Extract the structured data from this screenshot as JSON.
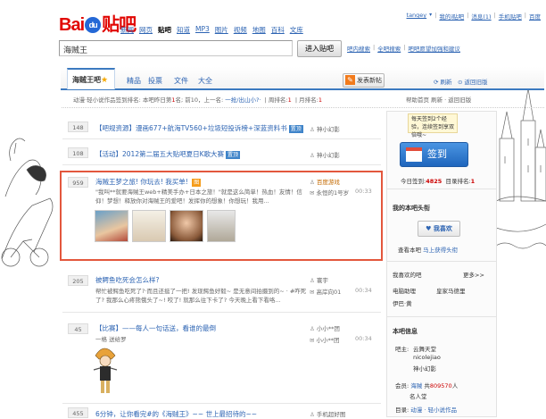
{
  "header": {
    "logo_text_bai": "Bai",
    "logo_text_du": "du",
    "logo_text_tieba": "贴吧",
    "nav": [
      "新闻",
      "网页",
      "贴吧",
      "知道",
      "MP3",
      "图片",
      "视频",
      "地图",
      "百科",
      "文库"
    ],
    "nav_current": "贴吧",
    "user": {
      "username": "tangey",
      "links": [
        "我的i贴吧",
        "消息(1)",
        "手机贴吧",
        "百度"
      ]
    },
    "search_value": "海贼王",
    "search_button": "进入贴吧",
    "tool_links": [
      "吧内搜索",
      "全吧搜索",
      "吧吧愿望加强和建议"
    ]
  },
  "tabs": {
    "active": "海贼王吧",
    "items": [
      "精品",
      "投票",
      "文件",
      "大全"
    ],
    "post_button": "发表新帖",
    "right_links": [
      "刷新",
      "返回旧版"
    ]
  },
  "infobar": {
    "text1": "动漫·轻小说作品签到排名: 本吧昨日第",
    "rank": "1",
    "text2": "名; 前10，上一名: ",
    "text3": "一抢/出山小?·",
    "members_label": "周排名:",
    "members_value": "1",
    "month_label": "月排名:",
    "month_value": "1",
    "right": "帮助首页 刷新 · 返回旧版"
  },
  "threads": [
    {
      "replies": "148",
      "title": "【吧规资源】漫画677+航海TV560+垃圾短投诉榜+深蓝资料书",
      "badge": "置顶",
      "author": "神小幻影",
      "time": "",
      "body": ""
    },
    {
      "replies": "108",
      "title": "【活动】2012第二届五大贴吧夏日K歌大赛",
      "badge": "置顶",
      "author": "神小幻影",
      "time": "",
      "body": ""
    },
    {
      "replies": "959",
      "title": "海贼王梦之旅! 你玩去! 我买单!",
      "badge": "",
      "author": "百度游戏",
      "author2": "永恒的1号岁",
      "time": "00:33",
      "body": "\"我叫**就要海贼王web+精美手办+日本之旅！\"就是这么简单！热血！友情！信仰！梦想！释放你对海贼王的爱吧！发挥你的想象！你想玩！我用..."
    },
    {
      "replies": "205",
      "title": "被鳄鱼吃死会怎么样?",
      "badge": "",
      "author": "寰宇",
      "author2": "高岸向01",
      "time": "00:34",
      "body": "帮忙被鳄鱼吃死了?·而且还挺了一把! 发现鳄鱼好毅~ 是无意间拍摄到的~ · #咋死了? 我那么心疼熊俄头了~! 咬了! 就那么往下卡了? 今天晚上看下看咯..."
    },
    {
      "replies": "45",
      "title": "【比赛】——每人一句话送，看谁的最倒",
      "badge": "",
      "author": "小小**团",
      "author2": "小小**团",
      "time": "00:34",
      "body": "一格 送给罗"
    },
    {
      "replies": "455",
      "title": "6分钟，让你看完#的《海贼王》~~ 世上最招待的~~",
      "badge": "",
      "author": "手机超好图",
      "time": "",
      "body": ""
    }
  ],
  "sidebar": {
    "sign_tip": "每天签到2个经验，连续签到享双倍哦~",
    "sign_button": "签到",
    "today_label": "今日签到:",
    "today_value": "4825",
    "rank_label": "目录排名:",
    "rank_value": "1",
    "my_head": "我的本吧头衔",
    "like_button": "我喜欢",
    "view_label": "查看本吧",
    "view_link": "马上获得头衔",
    "fav_head": "我喜欢的吧",
    "fav_more": "更多>>",
    "fav_items": [
      "电脑助理",
      "皇家马德里",
      "伊巴·黄"
    ],
    "info_head": "本吧信息",
    "mods_label": "吧主:",
    "mods": [
      "云舞天堂",
      "nicolejiao",
      "神小幻影"
    ],
    "members_label": "会员:",
    "members_name": "海贼",
    "members_count": "809570",
    "members_unit": "人",
    "titles_link": "名人堂",
    "category_label": "目录:",
    "category_value": "动漫 · 轻小说作品"
  },
  "colors": {
    "accent": "#3c7ac0",
    "link": "#2d64b3",
    "highlight_border": "#e3573d",
    "logo_red": "#e10602",
    "badge_blue": "#3f84c9"
  }
}
